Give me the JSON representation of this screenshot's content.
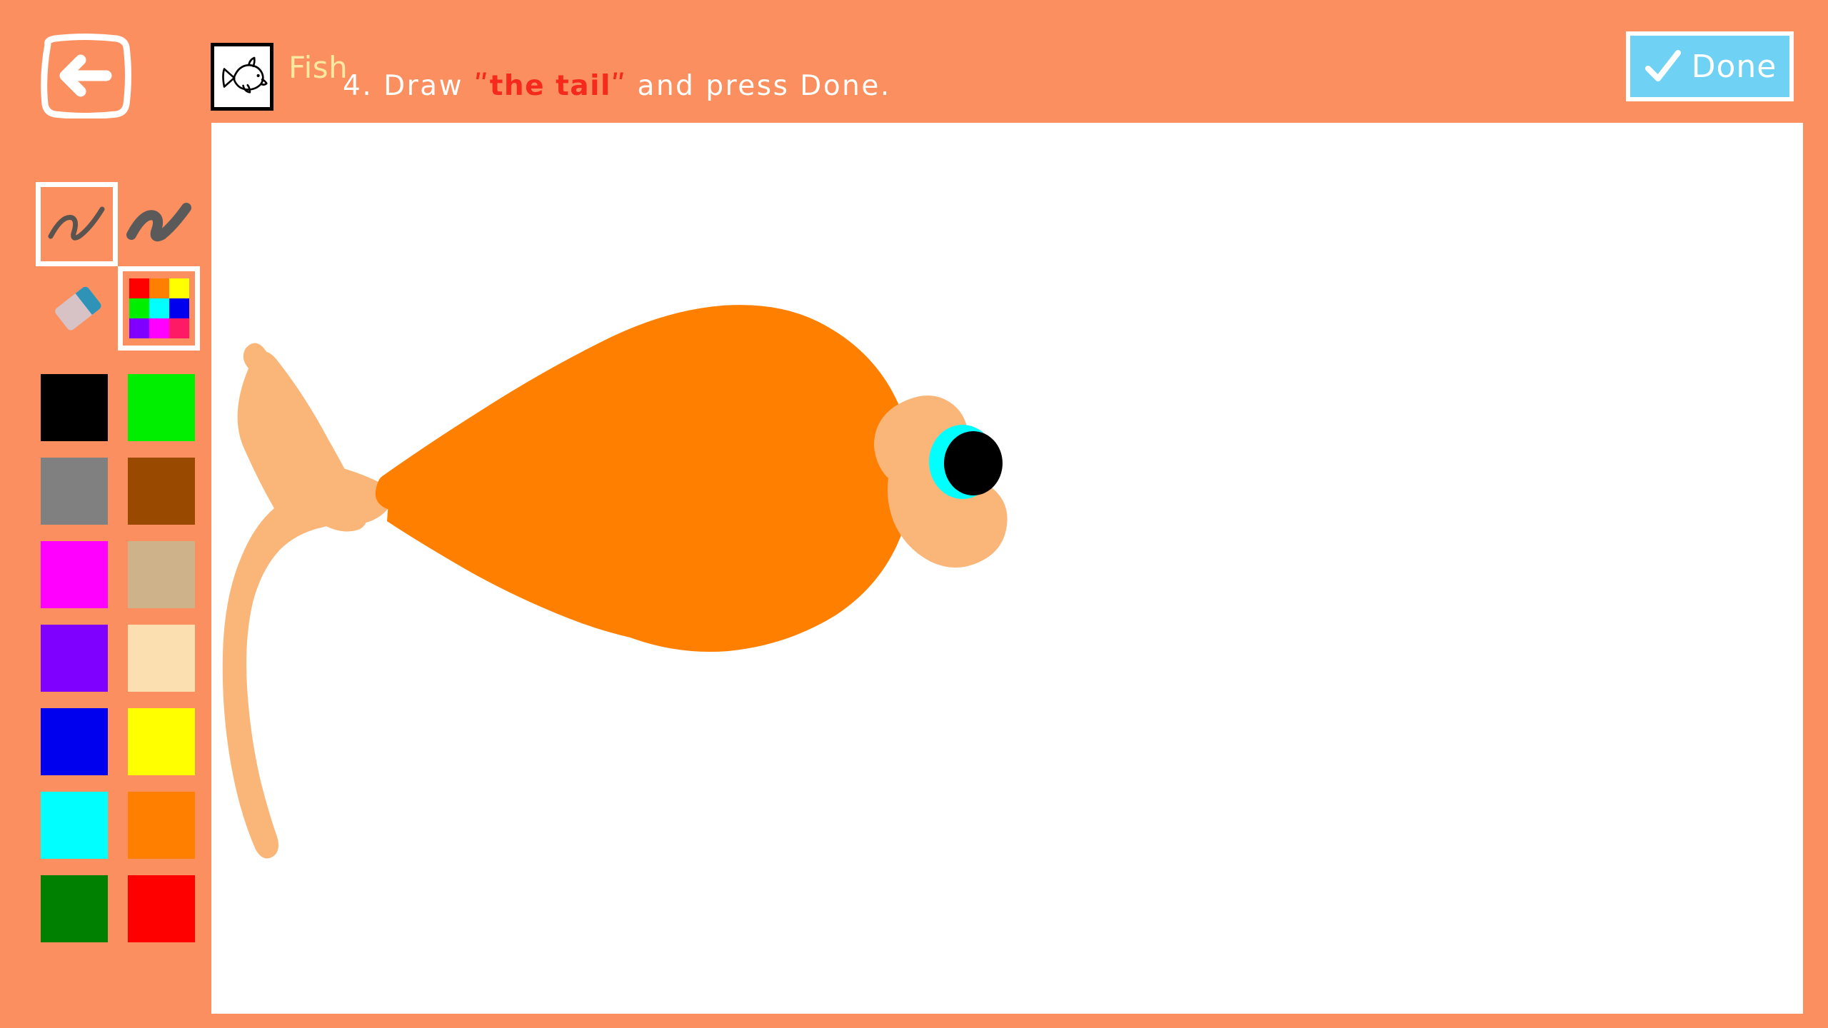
{
  "app": {
    "background_color": "#FB8F5F",
    "canvas_color": "#FFFFFF"
  },
  "header": {
    "back_label": "Back",
    "subject_title": "Fish",
    "subject_title_color": "#FCE8A0",
    "instruction_prefix": "4. Draw ",
    "instruction_target": "ʺthe tailʺ",
    "instruction_suffix": " and press Done.",
    "instruction_full": "4. Draw ʺthe tailʺ and press Done.",
    "instruction_color": "#FFFFFF",
    "instruction_target_color": "#F52A1C",
    "step_number": "4",
    "reference_icon": "fish-line-art"
  },
  "done_button": {
    "label": "Done",
    "icon": "checkmark-icon",
    "background_color": "#6FD2F5",
    "border_color": "#FFFFFF",
    "text_color": "#FFFFFF"
  },
  "toolbar": {
    "tools": [
      {
        "name": "thin-brush",
        "label": "Thin Brush",
        "selected": true,
        "stroke_width": 9,
        "stroke_color": "#595450"
      },
      {
        "name": "thick-brush",
        "label": "Thick Brush",
        "selected": false,
        "stroke_width": 20,
        "stroke_color": "#5A5A5A"
      },
      {
        "name": "eraser",
        "label": "Eraser",
        "selected": false,
        "body_color": "#D7C3C6",
        "band_color": "#2F93B8"
      },
      {
        "name": "color-picker",
        "label": "Color Picker",
        "selected": true,
        "swatch_colors": [
          "#FF0000",
          "#FF8000",
          "#FFFF00",
          "#00EE00",
          "#00FFFF",
          "#0000EE",
          "#7F00FF",
          "#FF00FF",
          "#FF1A66"
        ]
      }
    ],
    "palette": [
      {
        "name": "black",
        "hex": "#000000"
      },
      {
        "name": "green",
        "hex": "#00EE00"
      },
      {
        "name": "gray",
        "hex": "#808080"
      },
      {
        "name": "brown",
        "hex": "#9A4A00"
      },
      {
        "name": "magenta",
        "hex": "#FF00FF"
      },
      {
        "name": "tan",
        "hex": "#CDB28A"
      },
      {
        "name": "purple",
        "hex": "#7F00FF"
      },
      {
        "name": "light-peach",
        "hex": "#FCDFB0"
      },
      {
        "name": "blue",
        "hex": "#0000EE"
      },
      {
        "name": "yellow",
        "hex": "#FFFF00"
      },
      {
        "name": "cyan",
        "hex": "#00FFFF"
      },
      {
        "name": "orange",
        "hex": "#FF8000"
      },
      {
        "name": "dark-green",
        "hex": "#008000"
      },
      {
        "name": "red",
        "hex": "#FF0000"
      }
    ]
  },
  "drawing": {
    "subject": "fish",
    "body_color": "#FF8000",
    "fin_color": "#FAB678",
    "eye_iris_color": "#00FFFF",
    "eye_pupil_color": "#000000",
    "parts": [
      "body",
      "tail",
      "mouth-fin",
      "eye"
    ]
  }
}
